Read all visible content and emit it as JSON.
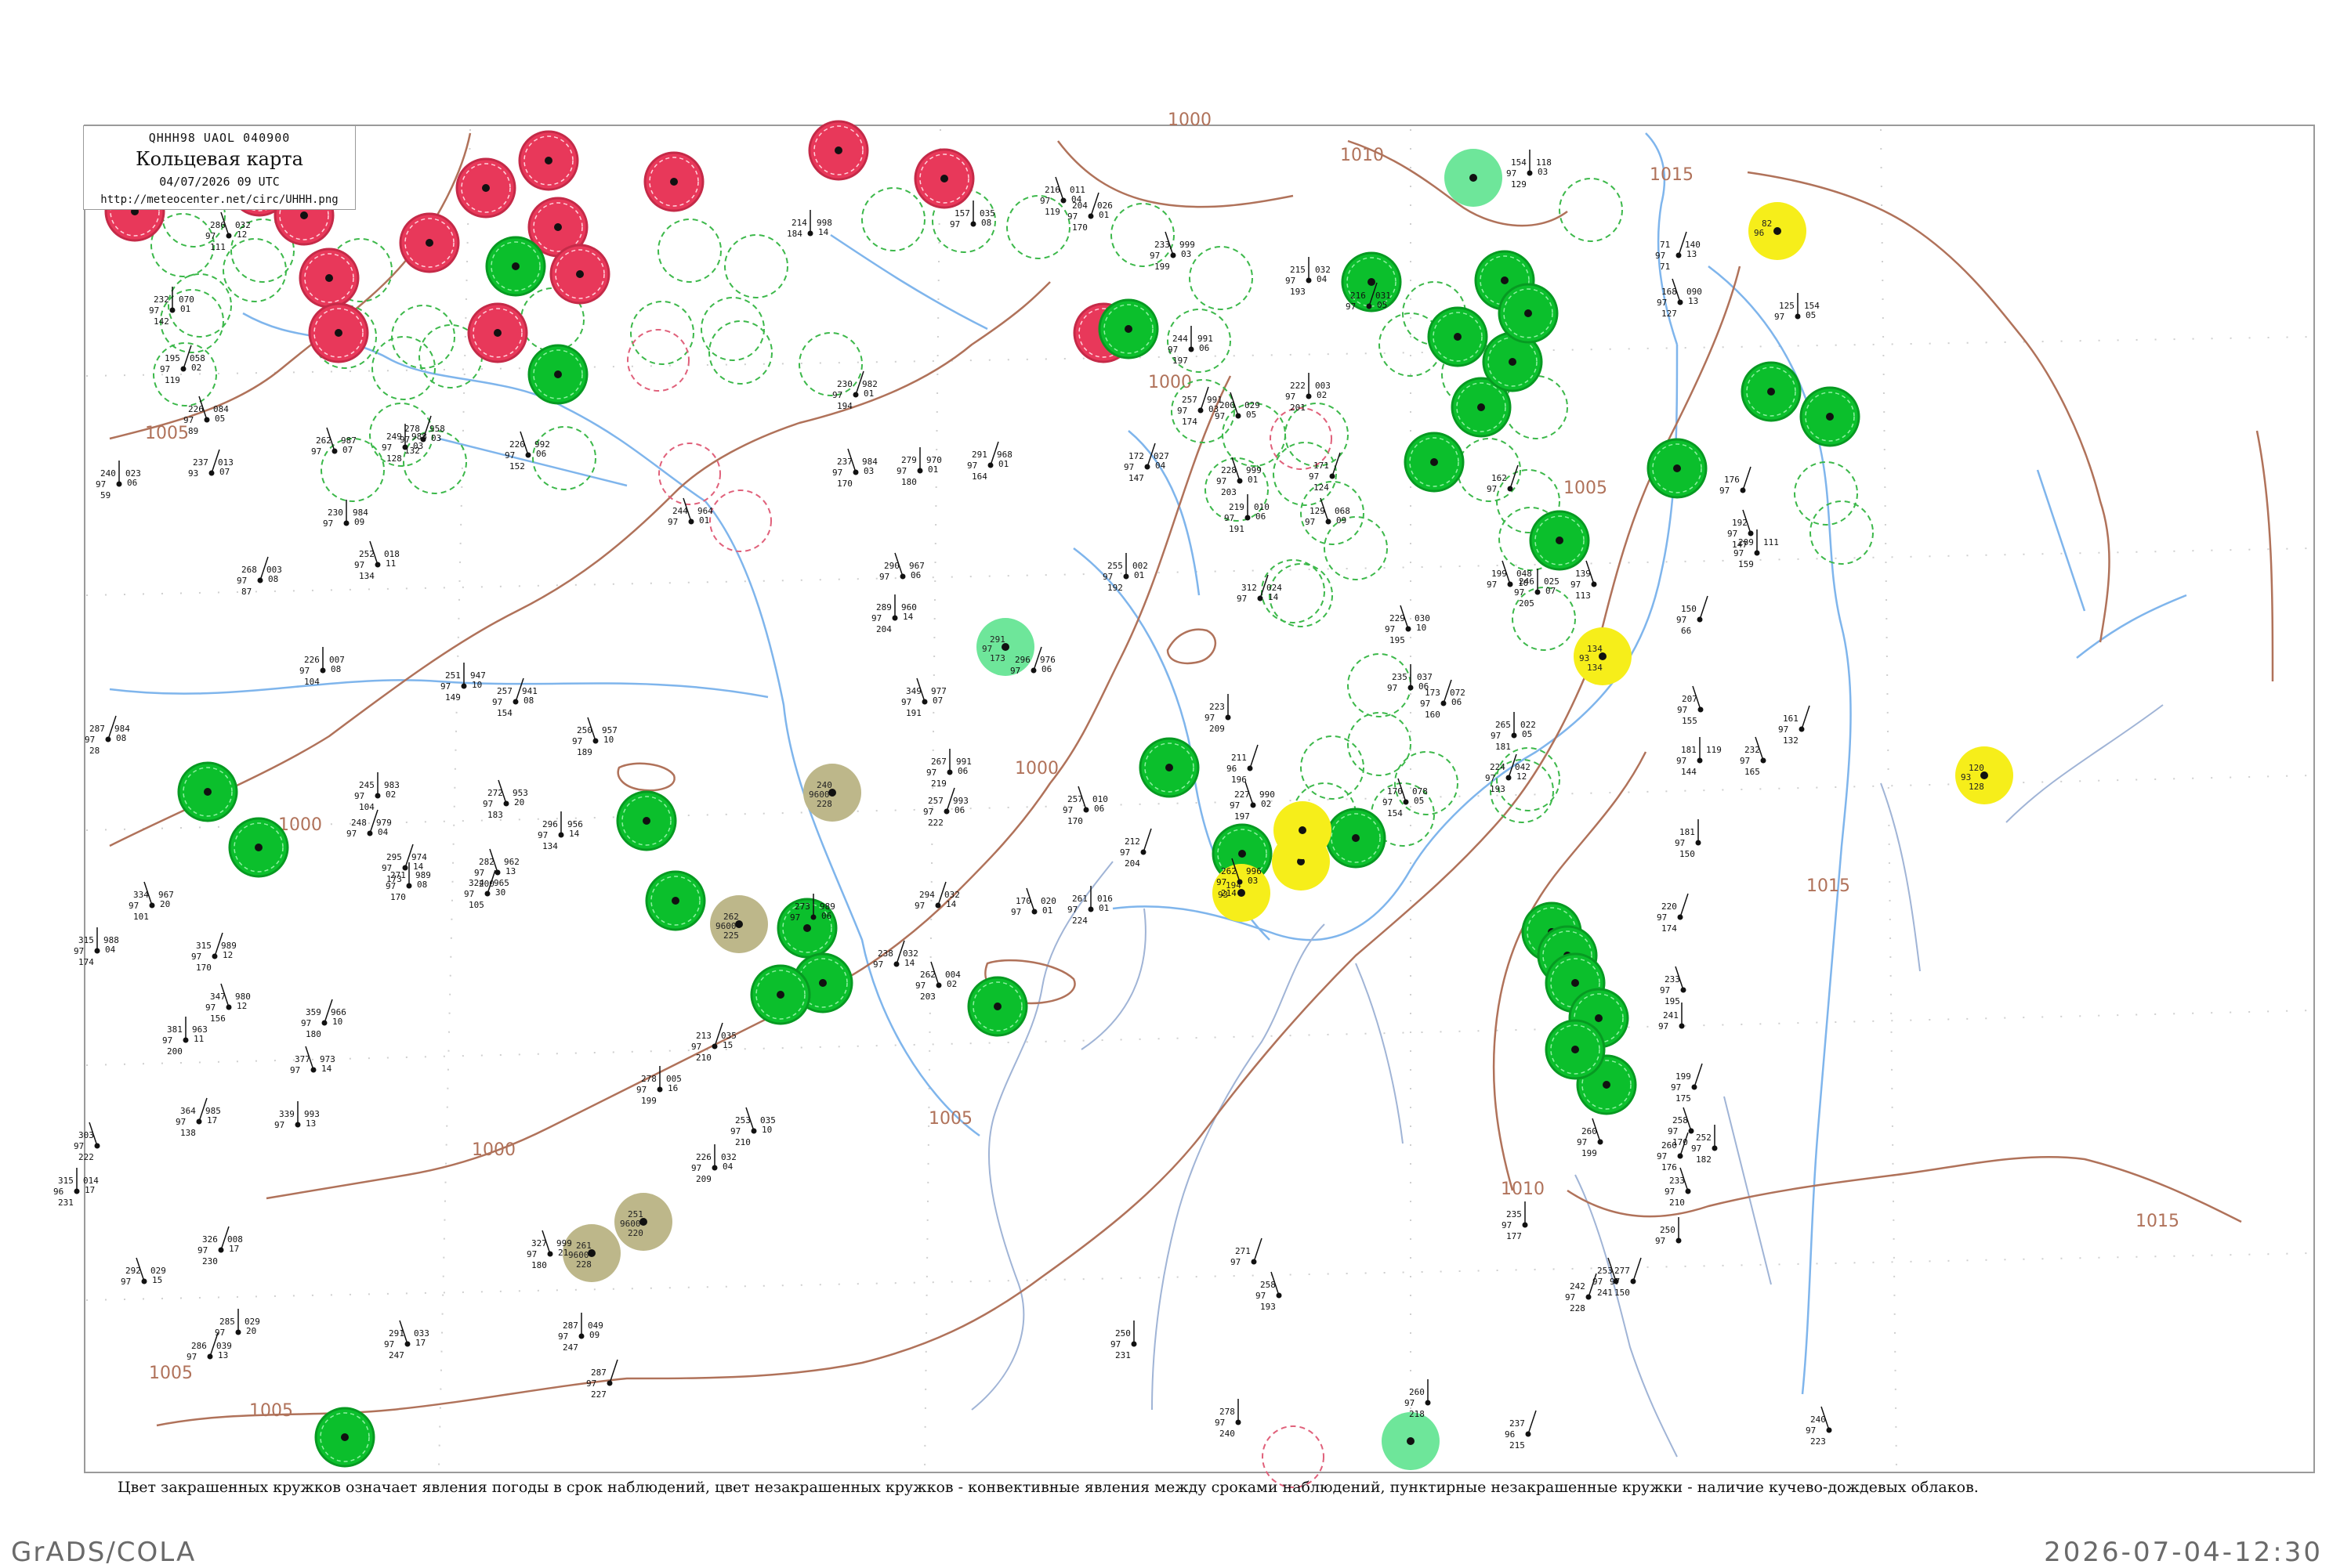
{
  "header": {
    "code": "QHHH98 UAOL 040900",
    "title": "Кольцевая карта",
    "datetime": "04/07/2026 09 UTC",
    "url": "http://meteocenter.net/circ/UHHH.png"
  },
  "legend_text": "Цвет закрашенных кружков означает явления погоды в срок наблюдений, цвет незакрашенных кружков - конвективные явления между сроками наблюдений, пунктирные незакрашенные кружки - наличие кучево-дождевых облаков.",
  "footer": {
    "left": "GrADS/COLA",
    "right": "2026-07-04-12:30"
  },
  "colors": {
    "red": "#e8385a",
    "green": "#0bbf2c",
    "light_green": "#6ee69a",
    "yellow": "#f6ee1a",
    "khaki": "#bdb78a",
    "isobar": "#b0725a",
    "river": "#7fb5ec",
    "coast": "#a0aec8"
  },
  "isobar_labels": [
    {
      "text": "1010"
    },
    {
      "text": "1015"
    },
    {
      "text": "1005"
    },
    {
      "text": "1000"
    },
    {
      "text": "1000"
    },
    {
      "text": "1005"
    },
    {
      "text": "1000"
    },
    {
      "text": "1000"
    },
    {
      "text": "1005"
    },
    {
      "text": "1005"
    },
    {
      "text": "1000"
    },
    {
      "text": "1015"
    },
    {
      "text": "1010"
    },
    {
      "text": "1015"
    },
    {
      "text": "1005"
    }
  ],
  "stations": [
    {
      "kind": "red",
      "t": "",
      "p": "",
      "m": ""
    },
    {
      "kind": "red",
      "t": "",
      "p": "",
      "m": ""
    },
    {
      "kind": "red",
      "t": "",
      "p": "",
      "m": ""
    },
    {
      "kind": "red",
      "t": "",
      "p": "",
      "m": ""
    },
    {
      "kind": "red",
      "t": "",
      "p": "",
      "m": ""
    },
    {
      "kind": "red",
      "t": "",
      "p": "",
      "m": ""
    },
    {
      "kind": "red",
      "t": "",
      "p": "",
      "m": ""
    },
    {
      "kind": "red",
      "t": "",
      "p": "",
      "m": ""
    },
    {
      "kind": "red",
      "t": "",
      "p": "",
      "m": ""
    },
    {
      "kind": "red",
      "t": "",
      "p": "",
      "m": ""
    },
    {
      "kind": "red",
      "t": "",
      "p": "",
      "m": ""
    },
    {
      "kind": "red",
      "t": "",
      "p": "",
      "m": ""
    },
    {
      "kind": "red",
      "t": "",
      "p": "",
      "m": ""
    },
    {
      "kind": "red",
      "t": "",
      "p": "",
      "m": ""
    },
    {
      "kind": "red",
      "t": "",
      "p": "",
      "m": ""
    },
    {
      "kind": "green",
      "t": "",
      "p": "",
      "m": ""
    },
    {
      "kind": "green",
      "t": "",
      "p": "",
      "m": ""
    },
    {
      "kind": "green",
      "t": "",
      "p": "",
      "m": ""
    },
    {
      "kind": "green",
      "t": "",
      "p": "",
      "m": ""
    },
    {
      "kind": "green",
      "t": "",
      "p": "",
      "m": ""
    },
    {
      "kind": "green",
      "t": "",
      "p": "",
      "m": ""
    },
    {
      "kind": "green",
      "t": "",
      "p": "",
      "m": ""
    },
    {
      "kind": "green",
      "t": "",
      "p": "",
      "m": ""
    },
    {
      "kind": "green",
      "t": "",
      "p": "",
      "m": ""
    },
    {
      "kind": "green",
      "t": "",
      "p": "",
      "m": ""
    },
    {
      "kind": "green",
      "t": "",
      "p": "",
      "m": ""
    },
    {
      "kind": "green",
      "t": "",
      "p": "",
      "m": ""
    },
    {
      "kind": "green",
      "t": "",
      "p": "",
      "m": ""
    },
    {
      "kind": "green",
      "t": "",
      "p": "",
      "m": ""
    },
    {
      "kind": "green",
      "t": "",
      "p": "",
      "m": ""
    },
    {
      "kind": "green",
      "t": "",
      "p": "",
      "m": ""
    },
    {
      "kind": "green",
      "t": "",
      "p": "",
      "m": ""
    },
    {
      "kind": "green",
      "t": "",
      "p": "",
      "m": ""
    },
    {
      "kind": "green",
      "t": "",
      "p": "",
      "m": ""
    },
    {
      "kind": "green",
      "t": "",
      "p": "",
      "m": ""
    },
    {
      "kind": "green",
      "t": "",
      "p": "",
      "m": ""
    },
    {
      "kind": "green",
      "t": "",
      "p": "",
      "m": ""
    },
    {
      "kind": "green",
      "t": "",
      "p": "",
      "m": ""
    },
    {
      "kind": "green",
      "t": "",
      "p": "",
      "m": ""
    },
    {
      "kind": "green",
      "t": "",
      "p": "",
      "m": ""
    },
    {
      "kind": "green",
      "t": "",
      "p": "",
      "m": ""
    },
    {
      "kind": "green",
      "t": "",
      "p": "",
      "m": ""
    },
    {
      "kind": "green",
      "t": "",
      "p": "",
      "m": ""
    },
    {
      "kind": "green",
      "t": "",
      "p": "",
      "m": ""
    },
    {
      "kind": "green",
      "t": "",
      "p": "",
      "m": ""
    },
    {
      "kind": "green",
      "t": "",
      "p": "",
      "m": ""
    },
    {
      "kind": "green",
      "t": "",
      "p": "",
      "m": ""
    },
    {
      "kind": "light_green",
      "t": "",
      "p": "",
      "m": ""
    },
    {
      "kind": "light_green",
      "t": "291",
      "p": "97",
      "m": "173"
    },
    {
      "kind": "light_green",
      "t": "",
      "p": "",
      "m": ""
    },
    {
      "kind": "yellow",
      "t": "82",
      "p": "96",
      "m": ""
    },
    {
      "kind": "yellow",
      "t": "134",
      "p": "93",
      "m": "134"
    },
    {
      "kind": "yellow",
      "t": "120",
      "p": "93",
      "m": "128"
    },
    {
      "kind": "yellow",
      "t": "194",
      "p": "93",
      "m": ""
    },
    {
      "kind": "yellow",
      "t": "",
      "p": "",
      "m": ""
    },
    {
      "kind": "yellow",
      "t": "",
      "p": "",
      "m": ""
    },
    {
      "kind": "khaki",
      "t": "240",
      "p": "9600",
      "m": "228"
    },
    {
      "kind": "khaki",
      "t": "262",
      "p": "9600",
      "m": "225"
    },
    {
      "kind": "khaki",
      "t": "251",
      "p": "9600",
      "m": "220"
    },
    {
      "kind": "khaki",
      "t": "261",
      "p": "9600",
      "m": "228"
    }
  ],
  "obs": [
    {
      "a": "286",
      "b": "97",
      "c": "111",
      "r": "032",
      "s": "12"
    },
    {
      "a": "232",
      "b": "97",
      "c": "142",
      "r": "070",
      "s": "01"
    },
    {
      "a": "195",
      "b": "97",
      "c": "119",
      "r": "058",
      "s": "02"
    },
    {
      "a": "226",
      "b": "97",
      "c": "89",
      "r": "084",
      "s": "05"
    },
    {
      "a": "240",
      "b": "97",
      "c": "59",
      "r": "023",
      "s": "06"
    },
    {
      "a": "237",
      "b": "93",
      "c": "",
      "r": "013",
      "s": "07"
    },
    {
      "a": "262",
      "b": "97",
      "c": "",
      "r": "987",
      "s": "07"
    },
    {
      "a": "249",
      "b": "97",
      "c": "128",
      "r": "988",
      "s": "03"
    },
    {
      "a": "268",
      "b": "97",
      "c": "87",
      "r": "003",
      "s": "08"
    },
    {
      "a": "252",
      "b": "97",
      "c": "134",
      "r": "018",
      "s": "11"
    },
    {
      "a": "226",
      "b": "97",
      "c": "104",
      "r": "007",
      "s": "08"
    },
    {
      "a": "287",
      "b": "97",
      "c": "28",
      "r": "984",
      "s": "08"
    },
    {
      "a": "220",
      "b": "97",
      "c": "152",
      "r": "992",
      "s": "06"
    },
    {
      "a": "230",
      "b": "97",
      "c": "",
      "r": "984",
      "s": "09"
    },
    {
      "a": "278",
      "b": "97",
      "c": "132",
      "r": "958",
      "s": "03"
    },
    {
      "a": "244",
      "b": "97",
      "c": "",
      "r": "964",
      "s": "01"
    },
    {
      "a": "214",
      "b": "184",
      "c": "",
      "r": "998",
      "s": "14"
    },
    {
      "a": "230",
      "b": "97",
      "c": "194",
      "r": "982",
      "s": "01"
    },
    {
      "a": "237",
      "b": "97",
      "c": "170",
      "r": "984",
      "s": "03"
    },
    {
      "a": "279",
      "b": "97",
      "c": "180",
      "r": "970",
      "s": "01"
    },
    {
      "a": "291",
      "b": "97",
      "c": "164",
      "r": "968",
      "s": "01"
    },
    {
      "a": "290",
      "b": "97",
      "c": "",
      "r": "967",
      "s": "06"
    },
    {
      "a": "289",
      "b": "97",
      "c": "204",
      "r": "960",
      "s": "14"
    },
    {
      "a": "296",
      "b": "97",
      "c": "",
      "r": "976",
      "s": "06"
    },
    {
      "a": "349",
      "b": "97",
      "c": "191",
      "r": "977",
      "s": "07"
    },
    {
      "a": "267",
      "b": "97",
      "c": "219",
      "r": "991",
      "s": "06"
    },
    {
      "a": "257",
      "b": "97",
      "c": "222",
      "r": "993",
      "s": "06"
    },
    {
      "a": "257",
      "b": "97",
      "c": "170",
      "r": "010",
      "s": "06"
    },
    {
      "a": "251",
      "b": "97",
      "c": "149",
      "r": "947",
      "s": "10"
    },
    {
      "a": "257",
      "b": "97",
      "c": "154",
      "r": "941",
      "s": "08"
    },
    {
      "a": "250",
      "b": "97",
      "c": "189",
      "r": "957",
      "s": "10"
    },
    {
      "a": "245",
      "b": "97",
      "c": "104",
      "r": "983",
      "s": "02"
    },
    {
      "a": "248",
      "b": "97",
      "c": "",
      "r": "979",
      "s": "04"
    },
    {
      "a": "272",
      "b": "97",
      "c": "183",
      "r": "953",
      "s": "20"
    },
    {
      "a": "296",
      "b": "97",
      "c": "134",
      "r": "956",
      "s": "14"
    },
    {
      "a": "295",
      "b": "97",
      "c": "173",
      "r": "974",
      "s": "14"
    },
    {
      "a": "282",
      "b": "97",
      "c": "200",
      "r": "962",
      "s": "13"
    },
    {
      "a": "271",
      "b": "97",
      "c": "170",
      "r": "989",
      "s": "08"
    },
    {
      "a": "324",
      "b": "97",
      "c": "105",
      "r": "965",
      "s": "30"
    },
    {
      "a": "334",
      "b": "97",
      "c": "101",
      "r": "967",
      "s": "20"
    },
    {
      "a": "315",
      "b": "97",
      "c": "174",
      "r": "988",
      "s": "04"
    },
    {
      "a": "315",
      "b": "97",
      "c": "170",
      "r": "989",
      "s": "12"
    },
    {
      "a": "347",
      "b": "97",
      "c": "156",
      "r": "980",
      "s": "12"
    },
    {
      "a": "381",
      "b": "97",
      "c": "200",
      "r": "963",
      "s": "11"
    },
    {
      "a": "359",
      "b": "97",
      "c": "180",
      "r": "966",
      "s": "10"
    },
    {
      "a": "377",
      "b": "97",
      "c": "",
      "r": "973",
      "s": "14"
    },
    {
      "a": "339",
      "b": "97",
      "c": "",
      "r": "993",
      "s": "13"
    },
    {
      "a": "364",
      "b": "97",
      "c": "138",
      "r": "985",
      "s": "17"
    },
    {
      "a": "303",
      "b": "97",
      "c": "222",
      "r": "",
      "s": ""
    },
    {
      "a": "315",
      "b": "96",
      "c": "231",
      "r": "014",
      "s": "17"
    },
    {
      "a": "326",
      "b": "97",
      "c": "230",
      "r": "008",
      "s": "17"
    },
    {
      "a": "292",
      "b": "97",
      "c": "",
      "r": "029",
      "s": "15"
    },
    {
      "a": "285",
      "b": "97",
      "c": "",
      "r": "029",
      "s": "20"
    },
    {
      "a": "286",
      "b": "97",
      "c": "",
      "r": "039",
      "s": "13"
    },
    {
      "a": "291",
      "b": "97",
      "c": "247",
      "r": "033",
      "s": "17"
    },
    {
      "a": "287",
      "b": "97",
      "c": "247",
      "r": "049",
      "s": "09"
    },
    {
      "a": "287",
      "b": "97",
      "c": "227",
      "r": "",
      "s": ""
    },
    {
      "a": "327",
      "b": "97",
      "c": "180",
      "r": "999",
      "s": "21"
    },
    {
      "a": "278",
      "b": "97",
      "c": "199",
      "r": "005",
      "s": "16"
    },
    {
      "a": "213",
      "b": "97",
      "c": "210",
      "r": "035",
      "s": "15"
    },
    {
      "a": "253",
      "b": "97",
      "c": "210",
      "r": "035",
      "s": "10"
    },
    {
      "a": "226",
      "b": "97",
      "c": "209",
      "r": "032",
      "s": "04"
    },
    {
      "a": "238",
      "b": "97",
      "c": "",
      "r": "032",
      "s": "14"
    },
    {
      "a": "262",
      "b": "97",
      "c": "203",
      "r": "004",
      "s": "02"
    },
    {
      "a": "273",
      "b": "97",
      "c": "",
      "r": "989",
      "s": "06"
    },
    {
      "a": "294",
      "b": "97",
      "c": "",
      "r": "032",
      "s": "14"
    },
    {
      "a": "170",
      "b": "97",
      "c": "",
      "r": "020",
      "s": "01"
    },
    {
      "a": "261",
      "b": "97",
      "c": "224",
      "r": "016",
      "s": "01"
    },
    {
      "a": "212",
      "b": "97",
      "c": "204",
      "r": "",
      "s": ""
    },
    {
      "a": "262",
      "b": "97",
      "c": "214",
      "r": "996",
      "s": "03"
    },
    {
      "a": "223",
      "b": "97",
      "c": "209",
      "r": "",
      "s": ""
    },
    {
      "a": "211",
      "b": "96",
      "c": "196",
      "r": "",
      "s": ""
    },
    {
      "a": "227",
      "b": "97",
      "c": "197",
      "r": "990",
      "s": "02"
    },
    {
      "a": "255",
      "b": "97",
      "c": "192",
      "r": "002",
      "s": "01"
    },
    {
      "a": "172",
      "b": "97",
      "c": "147",
      "r": "027",
      "s": "04"
    },
    {
      "a": "216",
      "b": "97",
      "c": "119",
      "r": "011",
      "s": "04"
    },
    {
      "a": "157",
      "b": "97",
      "c": "",
      "r": "035",
      "s": "08"
    },
    {
      "a": "204",
      "b": "97",
      "c": "170",
      "r": "026",
      "s": "01"
    },
    {
      "a": "233",
      "b": "97",
      "c": "199",
      "r": "999",
      "s": "03"
    },
    {
      "a": "244",
      "b": "97",
      "c": "197",
      "r": "991",
      "s": "06"
    },
    {
      "a": "257",
      "b": "97",
      "c": "174",
      "r": "991",
      "s": "03"
    },
    {
      "a": "228",
      "b": "97",
      "c": "203",
      "r": "999",
      "s": "01"
    },
    {
      "a": "219",
      "b": "97",
      "c": "191",
      "r": "010",
      "s": "06"
    },
    {
      "a": "312",
      "b": "97",
      "c": "",
      "r": "024",
      "s": "14"
    },
    {
      "a": "200",
      "b": "97",
      "c": "",
      "r": "029",
      "s": "05"
    },
    {
      "a": "222",
      "b": "97",
      "c": "201",
      "r": "003",
      "s": "02"
    },
    {
      "a": "171",
      "b": "97",
      "c": "124",
      "r": "",
      "s": ""
    },
    {
      "a": "129",
      "b": "97",
      "c": "",
      "r": "068",
      "s": "09"
    },
    {
      "a": "215",
      "b": "97",
      "c": "193",
      "r": "032",
      "s": "04"
    },
    {
      "a": "216",
      "b": "97",
      "c": "",
      "r": "031",
      "s": "05"
    },
    {
      "a": "229",
      "b": "97",
      "c": "195",
      "r": "030",
      "s": "10"
    },
    {
      "a": "235",
      "b": "97",
      "c": "",
      "r": "037",
      "s": "06"
    },
    {
      "a": "173",
      "b": "97",
      "c": "160",
      "r": "072",
      "s": "06"
    },
    {
      "a": "170",
      "b": "97",
      "c": "154",
      "r": "078",
      "s": "05"
    },
    {
      "a": "265",
      "b": "97",
      "c": "181",
      "r": "022",
      "s": "05"
    },
    {
      "a": "224",
      "b": "97",
      "c": "193",
      "r": "042",
      "s": "12"
    },
    {
      "a": "199",
      "b": "97",
      "c": "",
      "r": "048",
      "s": "10"
    },
    {
      "a": "246",
      "b": "97",
      "c": "205",
      "r": "025",
      "s": "07"
    },
    {
      "a": "162",
      "b": "97",
      "c": "",
      "r": "",
      "s": ""
    },
    {
      "a": "139",
      "b": "97",
      "c": "113",
      "r": "",
      "s": ""
    },
    {
      "a": "154",
      "b": "97",
      "c": "129",
      "r": "118",
      "s": "03"
    },
    {
      "a": "71",
      "b": "97",
      "c": "71",
      "r": "140",
      "s": "13"
    },
    {
      "a": "168",
      "b": "97",
      "c": "127",
      "r": "090",
      "s": "13"
    },
    {
      "a": "125",
      "b": "97",
      "c": "",
      "r": "154",
      "s": "05"
    },
    {
      "a": "176",
      "b": "97",
      "c": "",
      "r": "",
      "s": ""
    },
    {
      "a": "192",
      "b": "97",
      "c": "147",
      "r": "",
      "s": ""
    },
    {
      "a": "209",
      "b": "97",
      "c": "159",
      "r": "111",
      "s": ""
    },
    {
      "a": "150",
      "b": "97",
      "c": "66",
      "r": "",
      "s": ""
    },
    {
      "a": "207",
      "b": "97",
      "c": "155",
      "r": "",
      "s": ""
    },
    {
      "a": "181",
      "b": "97",
      "c": "144",
      "r": "119",
      "s": ""
    },
    {
      "a": "161",
      "b": "97",
      "c": "132",
      "r": "",
      "s": ""
    },
    {
      "a": "232",
      "b": "97",
      "c": "165",
      "r": "",
      "s": ""
    },
    {
      "a": "181",
      "b": "97",
      "c": "150",
      "r": "",
      "s": ""
    },
    {
      "a": "220",
      "b": "97",
      "c": "174",
      "r": "",
      "s": ""
    },
    {
      "a": "233",
      "b": "97",
      "c": "195",
      "r": "",
      "s": ""
    },
    {
      "a": "241",
      "b": "97",
      "c": "",
      "r": "",
      "s": ""
    },
    {
      "a": "199",
      "b": "97",
      "c": "175",
      "r": "",
      "s": ""
    },
    {
      "a": "258",
      "b": "97",
      "c": "170",
      "r": "",
      "s": ""
    },
    {
      "a": "252",
      "b": "97",
      "c": "182",
      "r": "",
      "s": ""
    },
    {
      "a": "260",
      "b": "97",
      "c": "176",
      "r": "",
      "s": ""
    },
    {
      "a": "233",
      "b": "97",
      "c": "210",
      "r": "",
      "s": ""
    },
    {
      "a": "250",
      "b": "97",
      "c": "",
      "r": "",
      "s": ""
    },
    {
      "a": "277",
      "b": "97",
      "c": "150",
      "r": "",
      "s": ""
    },
    {
      "a": "260",
      "b": "97",
      "c": "199",
      "r": "",
      "s": ""
    },
    {
      "a": "235",
      "b": "97",
      "c": "177",
      "r": "",
      "s": ""
    },
    {
      "a": "242",
      "b": "97",
      "c": "228",
      "r": "",
      "s": ""
    },
    {
      "a": "253",
      "b": "97",
      "c": "241",
      "r": "",
      "s": ""
    },
    {
      "a": "250",
      "b": "97",
      "c": "231",
      "r": "",
      "s": ""
    },
    {
      "a": "271",
      "b": "97",
      "c": "",
      "r": "",
      "s": ""
    },
    {
      "a": "258",
      "b": "97",
      "c": "193",
      "r": "",
      "s": ""
    },
    {
      "a": "260",
      "b": "97",
      "c": "218",
      "r": "",
      "s": ""
    },
    {
      "a": "237",
      "b": "96",
      "c": "215",
      "r": "",
      "s": ""
    },
    {
      "a": "240",
      "b": "97",
      "c": "223",
      "r": "",
      "s": ""
    },
    {
      "a": "278",
      "b": "97",
      "c": "240",
      "r": "",
      "s": ""
    }
  ]
}
